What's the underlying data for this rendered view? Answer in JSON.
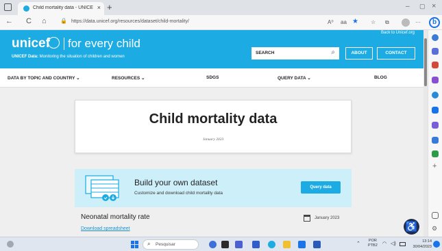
{
  "browser": {
    "tab_title": "Child mortality data - UNICEF D/",
    "tab_close": "×",
    "new_tab": "+",
    "url": "https://data.unicef.org/resources/dataset/child-mortality/",
    "nav": {
      "back": "←",
      "refresh": "C",
      "home": "⌂"
    },
    "toolbar": {
      "read_aloud": "A⁰",
      "immersive": "aa",
      "star": "★",
      "favorites": "☆",
      "collections": "⧉",
      "more": "···",
      "bing": "b"
    },
    "window": {
      "minimize": "–",
      "maximize": "▢",
      "close": "×"
    },
    "lock": "🔒"
  },
  "header": {
    "back_link": "Back to Unicef.org",
    "logo": "unicef",
    "tagline": "for every child",
    "subline_bold": "UNICEF Data:",
    "subline_rest": " Monitoring the situation of children and women",
    "search_label": "SEARCH",
    "search_icon": "⌕",
    "about": "ABOUT",
    "contact": "CONTACT"
  },
  "nav": [
    {
      "label": "DATA BY TOPIC AND COUNTRY ⌄"
    },
    {
      "label": "RESOURCES ⌄"
    },
    {
      "label": "SDGS"
    },
    {
      "label": "QUERY DATA ⌄"
    },
    {
      "label": "BLOG"
    }
  ],
  "hero": {
    "title": "Child mortality data",
    "date": "January 2023"
  },
  "dataset_banner": {
    "title": "Build your own dataset",
    "subtitle": "Customize and download child mortality data",
    "button": "Query data"
  },
  "indicator": {
    "title": "Neonatal mortality rate",
    "link": "Download spreadsheet",
    "date": "January 2023"
  },
  "accessibility_icon": "♿",
  "taskbar": {
    "search_icon": "⌕",
    "search_placeholder": "Pesquisar",
    "tray_arrow": "⌃",
    "lang_1": "POR",
    "lang_2": "PTB2",
    "wifi": "◠",
    "sound": "◁)",
    "time": "13:14",
    "date": "30/04/2023"
  },
  "colors": {
    "unicef_blue": "#1cabe2",
    "dataset_bg": "#cdeffa",
    "link": "#1a8fce"
  }
}
